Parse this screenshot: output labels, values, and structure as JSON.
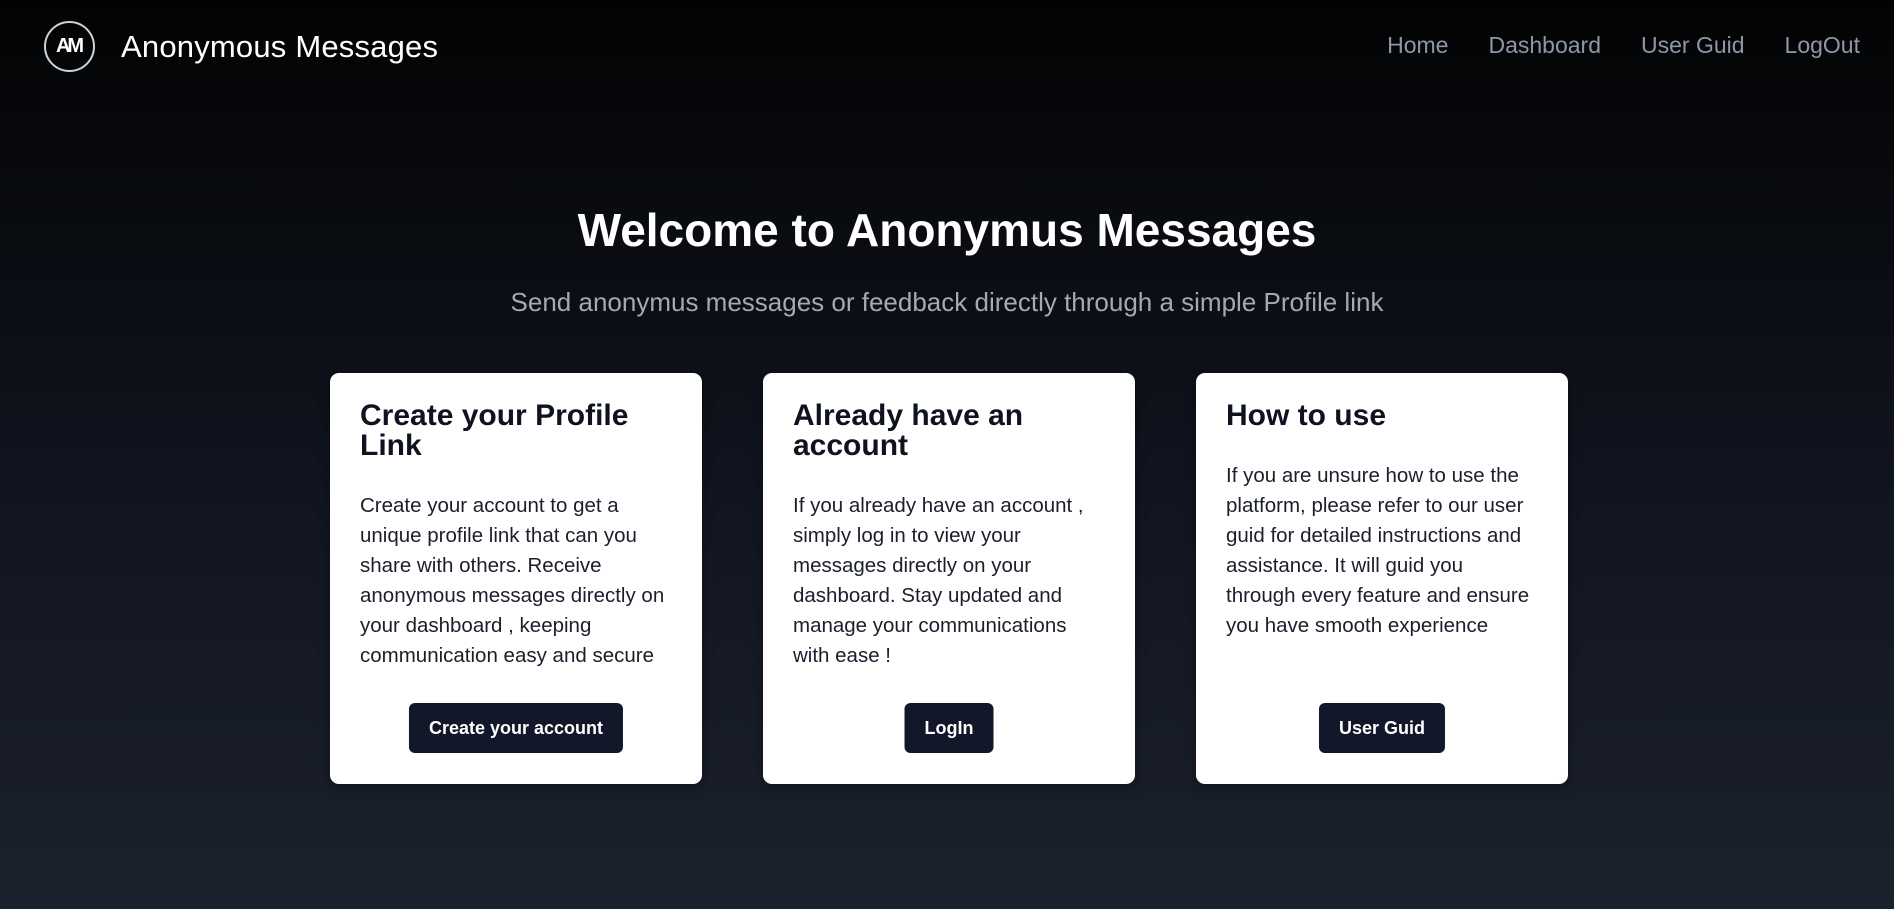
{
  "navbar": {
    "brand_logo_text": "AM",
    "brand_name": "Anonymous Messages",
    "links": [
      {
        "label": "Home"
      },
      {
        "label": "Dashboard"
      },
      {
        "label": "User Guid"
      },
      {
        "label": "LogOut"
      }
    ]
  },
  "hero": {
    "title": "Welcome to Anonymus Messages",
    "subtitle": "Send anonymus messages or feedback directly through a simple Profile link"
  },
  "cards": [
    {
      "title": "Create your Profile Link",
      "body": "Create your account to get a unique profile link that can you share with others. Receive anonymous messages directly on your dashboard , keeping communication easy and secure",
      "button": "Create your account"
    },
    {
      "title": "Already have an account",
      "body": "If you already have an account , simply log in to view your messages directly on your dashboard. Stay updated and manage your communications with ease !",
      "button": "LogIn"
    },
    {
      "title": "How to use",
      "body": "If you are unsure how to use the platform, please refer to our user guid for detailed instructions and assistance. It will guid you through every feature and ensure you have smooth experience",
      "button": "User Guid"
    }
  ],
  "colors": {
    "background_top": "#030303",
    "background_bottom": "#1b212d",
    "nav_link": "#8f97a7",
    "subtitle": "#a3a9b6",
    "button_bg": "#121829",
    "card_bg": "#ffffff"
  }
}
